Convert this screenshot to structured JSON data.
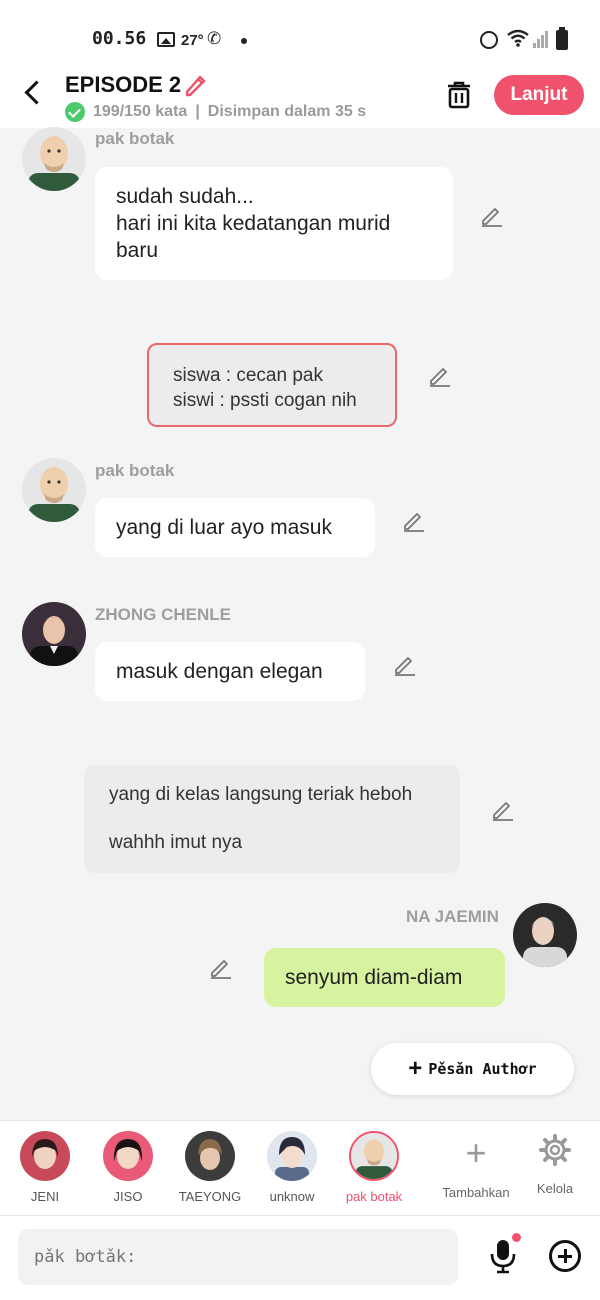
{
  "status_bar": {
    "time": "00.56",
    "temperature": "27°"
  },
  "header": {
    "title": "EPISODE 2",
    "word_count": "199/150 kata",
    "separator": "|",
    "save_status": "Disimpan dalam 35 s",
    "next_label": "Lanjut"
  },
  "messages": [
    {
      "speaker": "pak botak",
      "text_lines": [
        "sudah sudah...",
        "hari ini kita kedatangan murid",
        "baru"
      ]
    },
    {
      "narration_lines": [
        "siswa : cecan pak",
        "siswi : pssti cogan nih"
      ]
    },
    {
      "speaker": "pak botak",
      "text": "yang di luar ayo masuk"
    },
    {
      "speaker": "ZHONG CHENLE",
      "text": "masuk dengan elegan"
    },
    {
      "narration_lines": [
        "yang di kelas langsung teriak heboh",
        "wahhh imut nya"
      ]
    },
    {
      "speaker": "NA JAEMIN",
      "text": "senyum diam-diam"
    }
  ],
  "author_message_label": "Pěsǎn Authơr",
  "characters": [
    {
      "name": "JENI"
    },
    {
      "name": "JISO"
    },
    {
      "name": "TAEYONG"
    },
    {
      "name": "unknow"
    },
    {
      "name": "pak botak",
      "active": true
    }
  ],
  "tools": {
    "add_label": "Tambahkan",
    "manage_label": "Kelola"
  },
  "input": {
    "placeholder": "pǎk bơtǎk:"
  },
  "colors": {
    "accent": "#f0516c",
    "green_bubble": "#d7f3a0",
    "check": "#4cc96a"
  }
}
